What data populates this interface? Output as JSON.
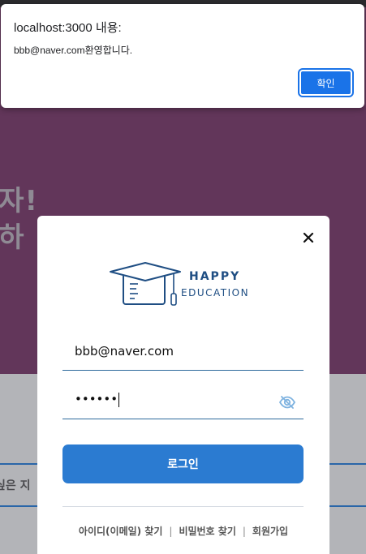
{
  "background": {
    "hero_line1": "자!",
    "hero_line2": "하",
    "partial_text": "싶은 지"
  },
  "alert": {
    "title": "localhost:3000 내용:",
    "message": "bbb@naver.com환영합니다.",
    "ok_label": "확인"
  },
  "modal": {
    "logo": {
      "line1": "HAPPY",
      "line2": "EDUCATION"
    },
    "email_value": "bbb@naver.com",
    "password_masked": "••••••",
    "login_label": "로그인",
    "links": {
      "find_id": "아이디(이메일) 찾기",
      "find_password": "비밀번호 찾기",
      "signup": "회원가입",
      "separator": "|"
    }
  },
  "colors": {
    "hero_bg": "#62365a",
    "primary": "#2b7bd1",
    "alert_button": "#1a73e8",
    "logo": "#1f4e83"
  }
}
